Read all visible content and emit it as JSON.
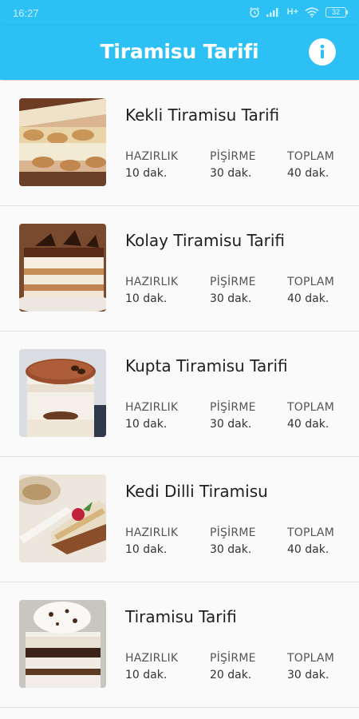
{
  "status_bar": {
    "time": "16:27",
    "network": "H+",
    "battery": "32"
  },
  "app_bar": {
    "title": "Tiramisu Tarifi",
    "info_icon": "info-icon"
  },
  "labels": {
    "prep": "HAZIRLIK",
    "cook": "PİŞİRME",
    "total": "TOPLAM"
  },
  "recipes": [
    {
      "title": "Kekli Tiramisu Tarifi",
      "prep": "10 dak.",
      "cook": "30 dak.",
      "total": "40 dak."
    },
    {
      "title": "Kolay Tiramisu Tarifi",
      "prep": "10 dak.",
      "cook": "30 dak.",
      "total": "40 dak."
    },
    {
      "title": "Kupta Tiramisu Tarifi",
      "prep": "10 dak.",
      "cook": "30 dak.",
      "total": "40 dak."
    },
    {
      "title": "Kedi Dilli Tiramisu",
      "prep": "10 dak.",
      "cook": "30 dak.",
      "total": "40 dak."
    },
    {
      "title": "Tiramisu Tarifi",
      "prep": "10 dak.",
      "cook": "20 dak.",
      "total": "30 dak."
    }
  ],
  "colors": {
    "primary": "#2cc0f4",
    "background": "#fafafa",
    "divider": "#e2e2e2"
  }
}
